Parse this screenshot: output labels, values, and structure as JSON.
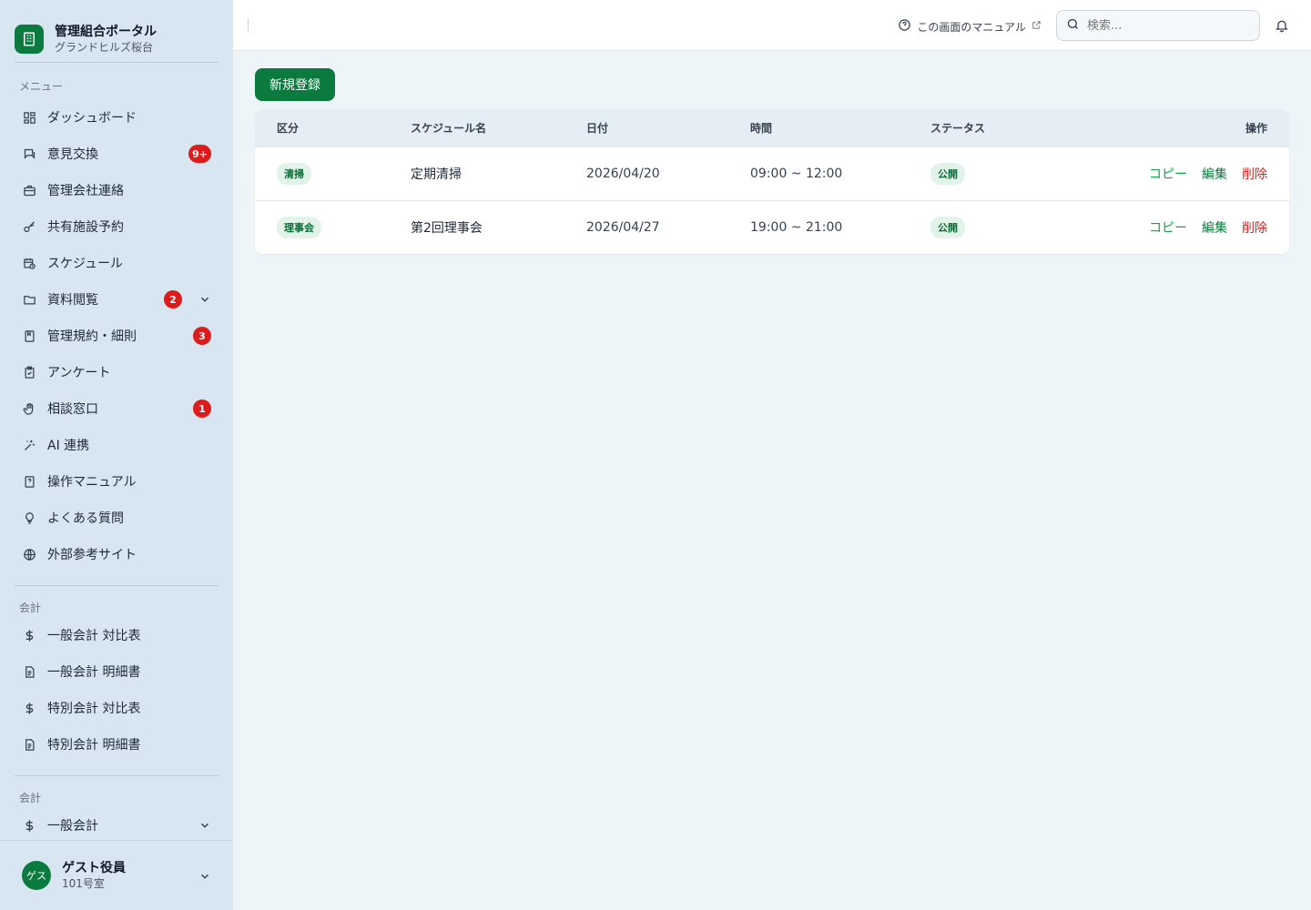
{
  "brand": {
    "title": "管理組合ポータル",
    "subtitle": "グランドヒルズ桜台"
  },
  "menu": {
    "section_label": "メニュー",
    "items": [
      {
        "label": "ダッシュボード",
        "icon": "dashboard-icon"
      },
      {
        "label": "意見交換",
        "icon": "chat-icon",
        "badge": "9+"
      },
      {
        "label": "管理会社連絡",
        "icon": "briefcase-icon"
      },
      {
        "label": "共有施設予約",
        "icon": "key-icon"
      },
      {
        "label": "スケジュール",
        "icon": "calendar-clock-icon"
      },
      {
        "label": "資料閲覧",
        "icon": "folder-icon",
        "badge": "2",
        "expandable": true
      },
      {
        "label": "管理規約・細則",
        "icon": "book-icon",
        "badge": "3"
      },
      {
        "label": "アンケート",
        "icon": "clipboard-icon"
      },
      {
        "label": "相談窓口",
        "icon": "hand-icon",
        "badge": "1"
      },
      {
        "label": "AI 連携",
        "icon": "sparkle-icon"
      },
      {
        "label": "操作マニュアル",
        "icon": "manual-icon"
      },
      {
        "label": "よくある質問",
        "icon": "lightbulb-icon"
      },
      {
        "label": "外部参考サイト",
        "icon": "globe-icon"
      }
    ]
  },
  "accounting": {
    "section_label": "会計",
    "items": [
      {
        "label": "一般会計 対比表",
        "icon": "dollar-icon"
      },
      {
        "label": "一般会計 明細書",
        "icon": "document-icon"
      },
      {
        "label": "特別会計 対比表",
        "icon": "dollar-icon"
      },
      {
        "label": "特別会計 明細書",
        "icon": "document-icon"
      }
    ]
  },
  "accounting2": {
    "section_label": "会計",
    "items": [
      {
        "label": "一般会計",
        "icon": "dollar-icon",
        "expandable": true
      }
    ]
  },
  "user": {
    "avatar": "ゲス",
    "name": "ゲスト役員",
    "room": "101号室"
  },
  "topbar": {
    "manual_link": "この画面のマニュアル",
    "search_placeholder": "検索..."
  },
  "toolbar": {
    "new_button": "新規登録"
  },
  "table": {
    "headers": [
      "区分",
      "スケジュール名",
      "日付",
      "時間",
      "ステータス",
      "操作"
    ],
    "rows": [
      {
        "category": "清掃",
        "name": "定期清掃",
        "date": "2026/04/20",
        "time": "09:00 ~ 12:00",
        "status": "公開"
      },
      {
        "category": "理事会",
        "name": "第2回理事会",
        "date": "2026/04/27",
        "time": "19:00 ~ 21:00",
        "status": "公開"
      }
    ],
    "actions": {
      "copy": "コピー",
      "edit": "編集",
      "delete": "削除"
    }
  },
  "colors": {
    "brand": "#0b7a3e",
    "badge": "#dc1c1c",
    "delete": "#dc2626",
    "sidebar_bg": "#d7e6f0"
  }
}
